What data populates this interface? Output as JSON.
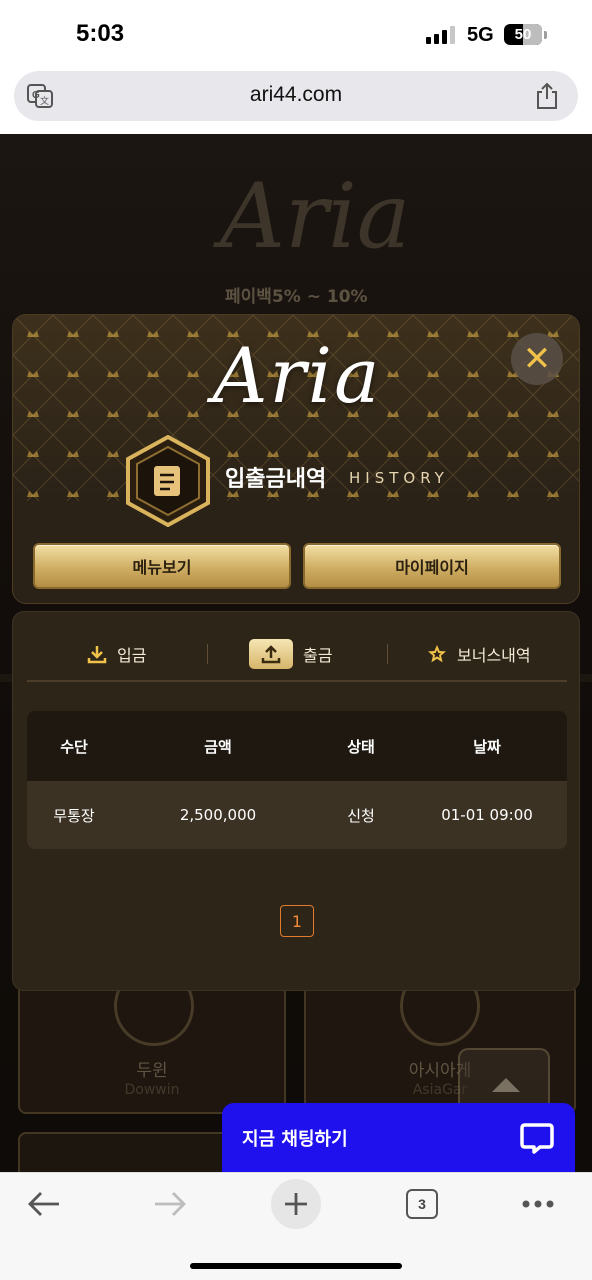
{
  "status_bar": {
    "time": "5:03",
    "network": "5G",
    "battery": "50",
    "battery_level": 0.5
  },
  "browser": {
    "url": "ari44.com"
  },
  "background": {
    "logo_text": "Aria",
    "promo_text": "페이백5% ~ 10%",
    "cards": [
      {
        "title": "두윈",
        "subtitle": "Dowwin"
      },
      {
        "title": "아시아게",
        "subtitle": "AsiaGar"
      }
    ]
  },
  "modal": {
    "logo_text": "Aria",
    "title_ko": "입출금내역",
    "title_en": "HISTORY",
    "buttons": {
      "menu": "메뉴보기",
      "mypage": "마이페이지"
    },
    "tabs": [
      {
        "label": "입금",
        "icon": "download-icon",
        "active": false
      },
      {
        "label": "출금",
        "icon": "upload-icon",
        "active": true
      },
      {
        "label": "보너스내역",
        "icon": "star-icon",
        "active": false
      }
    ],
    "table": {
      "headers": [
        "수단",
        "금액",
        "상태",
        "날짜"
      ],
      "rows": [
        [
          "무통장",
          "2,500,000",
          "신청",
          "01-01 09:00"
        ]
      ]
    },
    "pagination": {
      "current": "1"
    }
  },
  "chat": {
    "label": "지금 채팅하기"
  },
  "toolbar": {
    "tab_count": "3"
  },
  "colors": {
    "gold": "#d6b56a",
    "chat_blue": "#1f10ee",
    "page_active": "#e07b2c"
  }
}
